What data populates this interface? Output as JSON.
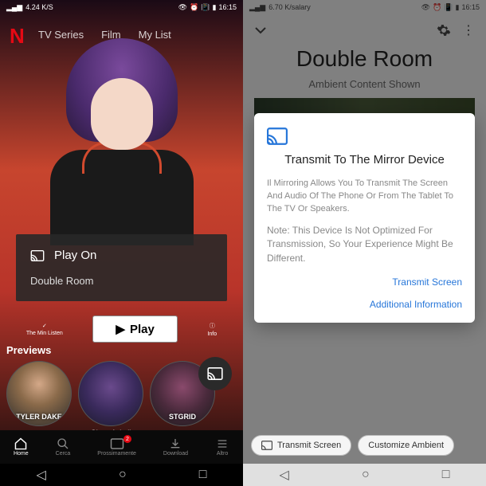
{
  "left": {
    "status": {
      "signal": "4.24 K/S",
      "time": "16:15"
    },
    "logo": "N",
    "tabs": [
      "TV Series",
      "Film",
      "My List"
    ],
    "cast_card": {
      "title": "Play On",
      "device": "Double Room"
    },
    "actions": {
      "mylist": "The Min Listen",
      "play": "Play",
      "info": "Info"
    },
    "previews_title": "Previews",
    "previews": [
      {
        "label": "",
        "overlay": "TYLER\nDAKE"
      },
      {
        "label": "Ghost Ashell",
        "overlay": ""
      },
      {
        "label": "",
        "overlay": "STGRID"
      }
    ],
    "nav": {
      "home": "Home",
      "search": "Cerca",
      "coming": "Prossimamente",
      "download": "Download",
      "more": "Altro",
      "badge": "2"
    }
  },
  "right": {
    "status": {
      "signal": "6.70 K/salary",
      "time": "16:15"
    },
    "title": "Double Room",
    "subtitle": "Ambient Content Shown",
    "dialog": {
      "title": "Transmit To The Mirror Device",
      "body": "Il Mirroring Allows You To Transmit The Screen And Audio Of The Phone Or From The Tablet To The TV Or Speakers.",
      "note": "Note: This Device Is Not Optimized For Transmission, So Your Experience Might Be Different.",
      "primary": "Transmit Screen",
      "secondary": "Additional Information"
    },
    "chips": {
      "transmit": "Transmit Screen",
      "customize": "Customize Ambient"
    }
  }
}
